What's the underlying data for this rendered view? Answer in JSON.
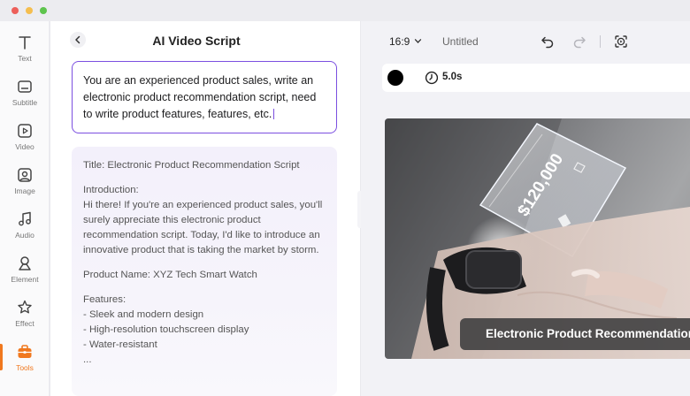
{
  "window": {
    "controls": [
      "close",
      "minimize",
      "zoom"
    ]
  },
  "rail": {
    "items": [
      {
        "label": "Text",
        "icon": "text-icon"
      },
      {
        "label": "Subtitle",
        "icon": "subtitle-icon"
      },
      {
        "label": "Video",
        "icon": "video-icon"
      },
      {
        "label": "Image",
        "icon": "image-icon"
      },
      {
        "label": "Audio",
        "icon": "audio-icon"
      },
      {
        "label": "Element",
        "icon": "element-icon"
      },
      {
        "label": "Effect",
        "icon": "effect-icon"
      },
      {
        "label": "Tools",
        "icon": "tools-icon"
      }
    ],
    "active": "Tools",
    "active_color": "#f0781e"
  },
  "panel": {
    "title": "AI Video Script",
    "prompt": "You are an experienced product sales, write an electronic product recommendation script, need to write product features, features, etc.",
    "result": {
      "title_line": "Title: Electronic Product Recommendation Script",
      "intro_heading": "Introduction:",
      "intro_body": "Hi there! If you're an experienced product sales, you'll surely appreciate this electronic product recommendation script. Today, I'd like to introduce an innovative product that is taking the market by storm.",
      "product_name": "Product Name: XYZ Tech Smart Watch",
      "features_heading": "Features:",
      "features": [
        "- Sleek and modern design",
        "- High-resolution touchscreen display",
        "- Water-resistant"
      ],
      "more": "..."
    },
    "accent_color": "#7b4fe0"
  },
  "editor": {
    "aspect_ratio": "16:9",
    "doc_title": "Untitled",
    "background_color": "#000000",
    "duration": "5.0s",
    "preview": {
      "hologram_amount": "$120,000",
      "caption": "Electronic Product Recommendation"
    }
  }
}
